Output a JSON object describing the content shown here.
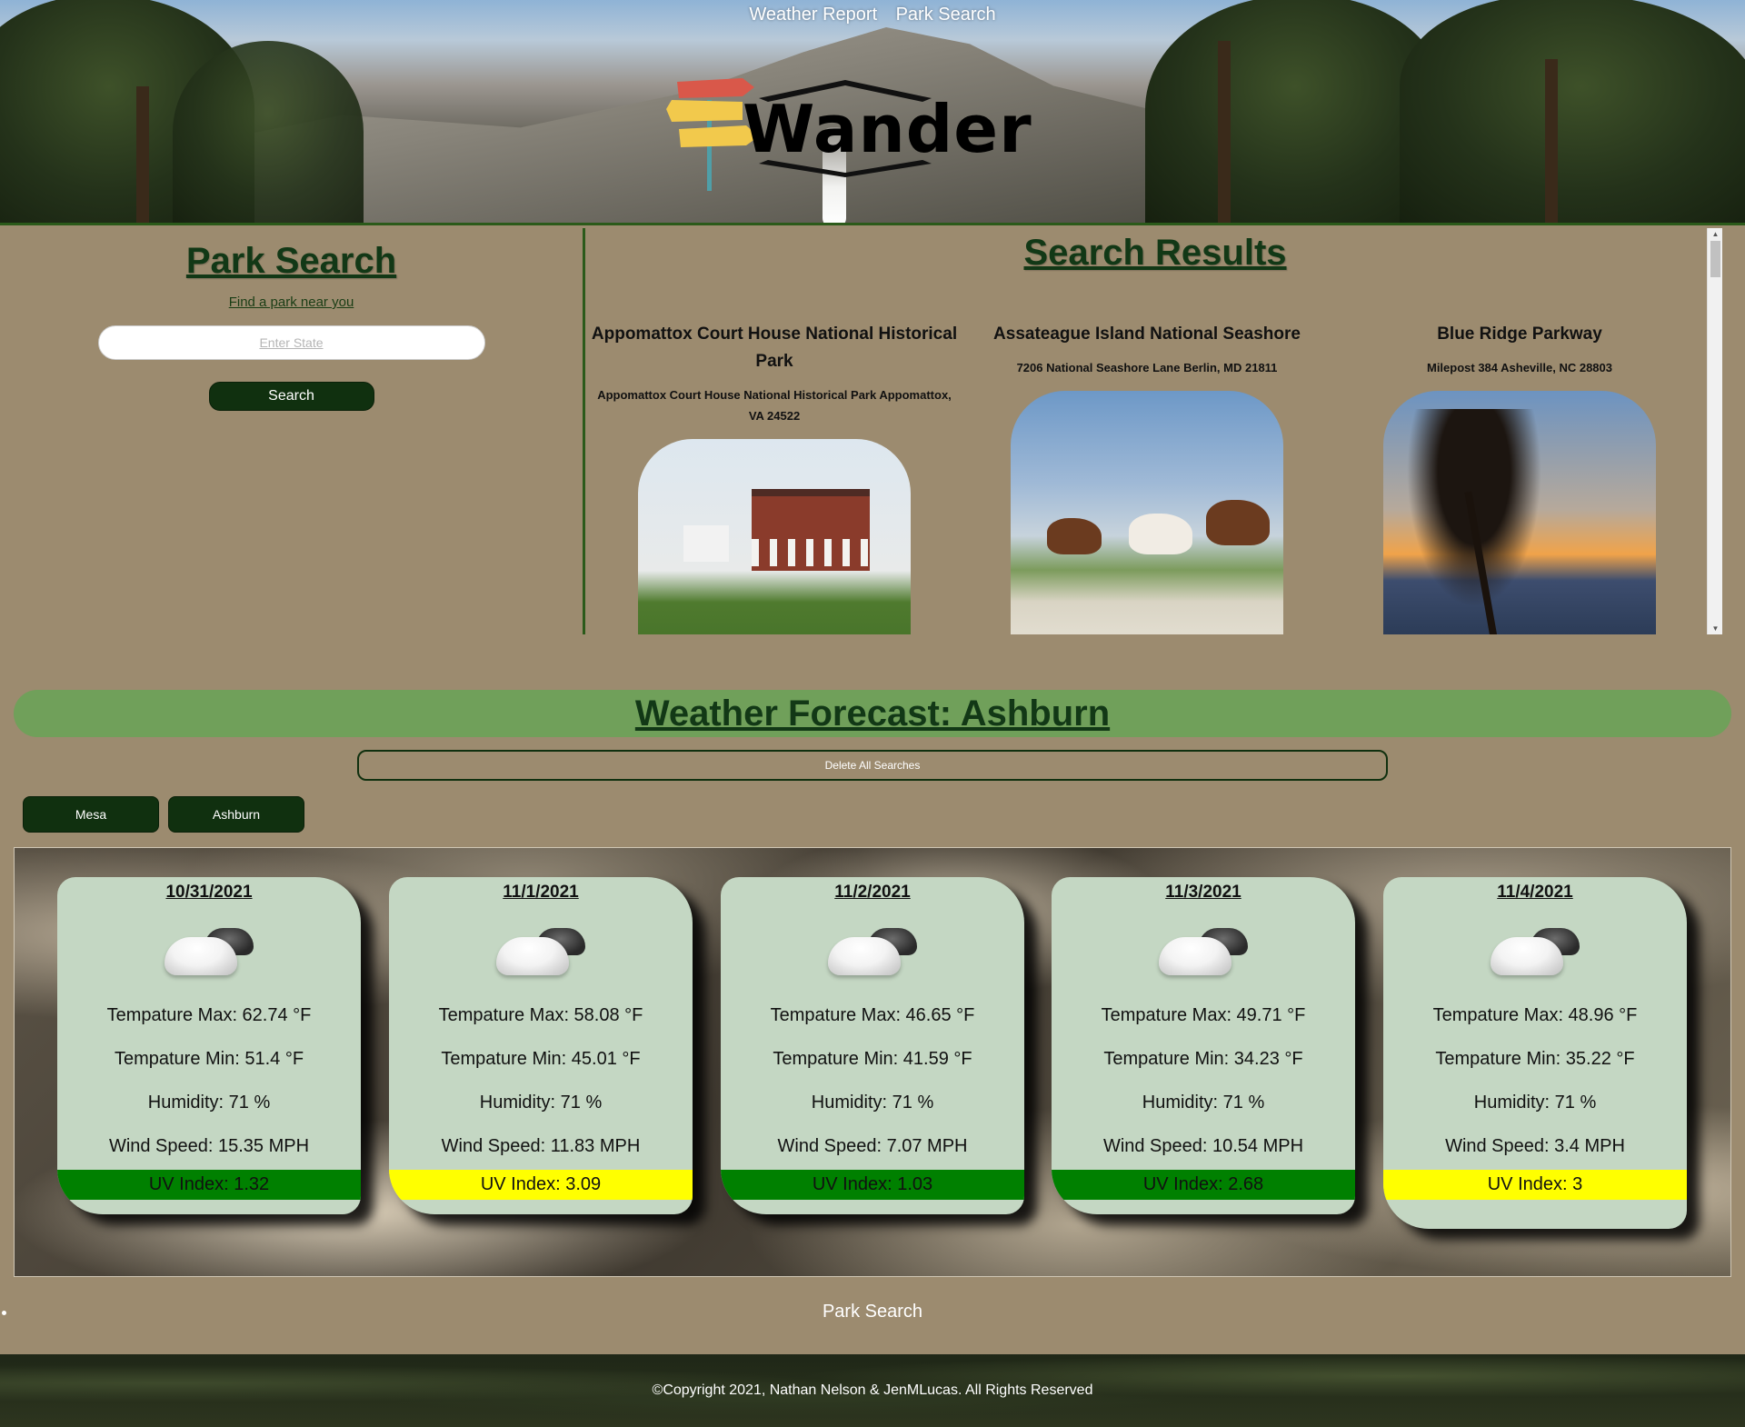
{
  "nav": {
    "items": [
      "Weather Report",
      "Park Search"
    ]
  },
  "logo": {
    "text": "Wander",
    "colors": [
      "#d9584a",
      "#f2c94c",
      "#4f9fa8"
    ]
  },
  "park_search": {
    "title": "Park Search",
    "subtitle": "Find a park near you",
    "input_placeholder": "Enter State",
    "input_value": "",
    "button_label": "Search"
  },
  "results": {
    "title": "Search Results",
    "parks": [
      {
        "name": "Appomattox Court House National Historical Park",
        "address": "Appomattox Court House National Historical Park Appomattox, VA 24522",
        "image": "red-brick-house-photo"
      },
      {
        "name": "Assateague Island National Seashore",
        "address": "7206 National Seashore Lane Berlin, MD 21811",
        "image": "wild-horses-beach-photo"
      },
      {
        "name": "Blue Ridge Parkway",
        "address": "Milepost 384 Asheville, NC 28803",
        "image": "tree-sunset-mountains-photo"
      }
    ]
  },
  "weather": {
    "title": "Weather Forecast: Ashburn",
    "delete_label": "Delete All Searches",
    "saved_cities": [
      "Mesa",
      "Ashburn"
    ],
    "days": [
      {
        "date": "10/31/2021",
        "icon": "partly-cloudy-icon",
        "temp_max": "Tempature Max: 62.74 °F",
        "temp_min": "Tempature Min: 51.4 °F",
        "humidity": "Humidity: 71 %",
        "wind": "Wind Speed: 15.35 MPH",
        "uv": "UV Index: 1.32",
        "uv_color": "#008000"
      },
      {
        "date": "11/1/2021",
        "icon": "partly-cloudy-icon",
        "temp_max": "Tempature Max: 58.08 °F",
        "temp_min": "Tempature Min: 45.01 °F",
        "humidity": "Humidity: 71 %",
        "wind": "Wind Speed: 11.83 MPH",
        "uv": "UV Index: 3.09",
        "uv_color": "#ffff00"
      },
      {
        "date": "11/2/2021",
        "icon": "partly-cloudy-icon",
        "temp_max": "Tempature Max: 46.65 °F",
        "temp_min": "Tempature Min: 41.59 °F",
        "humidity": "Humidity: 71 %",
        "wind": "Wind Speed: 7.07 MPH",
        "uv": "UV Index: 1.03",
        "uv_color": "#008000"
      },
      {
        "date": "11/3/2021",
        "icon": "partly-cloudy-icon",
        "temp_max": "Tempature Max: 49.71 °F",
        "temp_min": "Tempature Min: 34.23 °F",
        "humidity": "Humidity: 71 %",
        "wind": "Wind Speed: 10.54 MPH",
        "uv": "UV Index: 2.68",
        "uv_color": "#008000"
      },
      {
        "date": "11/4/2021",
        "icon": "partly-cloudy-icon",
        "temp_max": "Tempature Max: 48.96 °F",
        "temp_min": "Tempature Min: 35.22 °F",
        "humidity": "Humidity: 71 %",
        "wind": "Wind Speed: 3.4 MPH",
        "uv": "UV Index: 3",
        "uv_color": "#ffff00"
      }
    ]
  },
  "footer": {
    "nav_item": "Park Search",
    "copyright": "©Copyright 2021, Nathan Nelson & JenMLucas. All Rights Reserved"
  },
  "colors": {
    "page_bg": "#9c8b6f",
    "accent_dark_green": "#10300f",
    "banner_green": "#70a05a",
    "card_bg": "#c4d7c3"
  }
}
